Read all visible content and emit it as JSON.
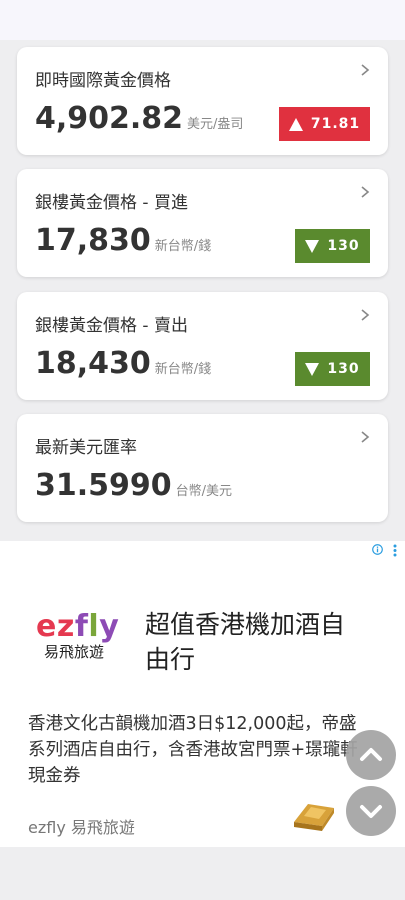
{
  "cards": [
    {
      "title": "即時國際黃金價格",
      "value": "4,902.82",
      "unit": "美元/盎司",
      "change": "71.81",
      "direction": "up"
    },
    {
      "title": "銀樓黃金價格 - 買進",
      "value": "17,830",
      "unit": "新台幣/錢",
      "change": "130",
      "direction": "down"
    },
    {
      "title": "銀樓黃金價格 - 賣出",
      "value": "18,430",
      "unit": "新台幣/錢",
      "change": "130",
      "direction": "down"
    },
    {
      "title": "最新美元匯率",
      "value": "31.5990",
      "unit": "台幣/美元"
    }
  ],
  "colors": {
    "up": "#e0313f",
    "down": "#5a8a2e"
  },
  "ad": {
    "logo_letters": [
      {
        "ch": "e",
        "color": "#e53950"
      },
      {
        "ch": "z",
        "color": "#e53950"
      },
      {
        "ch": "f",
        "color": "#8d4bb5"
      },
      {
        "ch": "l",
        "color": "#7aa63a"
      },
      {
        "ch": "y",
        "color": "#8d4bb5"
      }
    ],
    "brand_sub": "易飛旅遊",
    "headline": "超值香港機加酒自由行",
    "body": "香港文化古韻機加酒3日$12,000起，帝盛系列酒店自由行，含香港故宮門票+璟瓏軒現金券",
    "advertiser": "ezfly 易飛旅遊"
  },
  "icons": [
    "chevron-right-icon",
    "ad-info-icon",
    "more-vert-icon",
    "gold-bar-icon",
    "chevron-up-icon",
    "chevron-down-icon"
  ]
}
